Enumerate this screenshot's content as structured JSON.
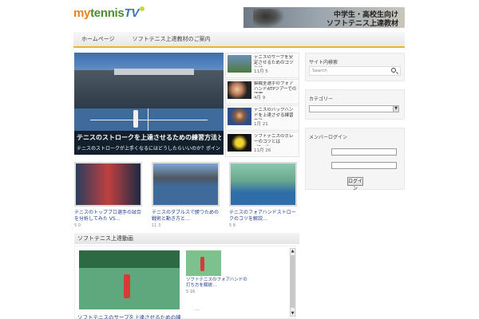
{
  "site": {
    "logo_part1": "my",
    "logo_part2": "tennis",
    "logo_part3": "TV"
  },
  "banner": {
    "line1": "中学生・高校生向け",
    "line2": "ソフトテニス上達教材"
  },
  "nav": {
    "items": [
      "ホームページ",
      "ソフトテニス上達教材のご案内"
    ]
  },
  "featured": {
    "title": "テニスのストロークを上達させるための練習方法とは…",
    "subtitle": "テニスのストロークが上手くなるにはどうしたらいいのか？ポイントを解説"
  },
  "side_list": [
    {
      "title": "テニスのサーブを安定させるためのコツとは…",
      "date": "11月 5"
    },
    {
      "title": "錦織圭選手のフォアハンドATPツアーでの活躍…",
      "date": "4月 9"
    },
    {
      "title": "テニスのバックハンドを上達させる練習方法…",
      "date": "1月 21"
    },
    {
      "title": "ソフトテニスのボレーのコツとは（Part）…",
      "date": "11月 26"
    }
  ],
  "grid": [
    {
      "title": "テニスのトッププロ選手の試合を分析してみた VS…",
      "meta": "5 0"
    },
    {
      "title": "テニスのダブルスで勝つための戦術と動き方と…",
      "meta": "11 3"
    },
    {
      "title": "テニスのフォアハンドストロークのコツを解説…",
      "meta": "5 8"
    }
  ],
  "section": {
    "header": "ソフトテニス上達動画"
  },
  "lower": {
    "small_title": "ソフトテニスのフォアハンドの打ち方を解説…",
    "small_meta": "5 16",
    "dots": "...",
    "caption": "ソフトテニスのサーブを上達させるための練習法"
  },
  "sidebar": {
    "search_title": "サイト内検索",
    "search_placeholder": "Search",
    "category_title": "カテゴリー",
    "login_title": "メンバーログイン",
    "login_user_label": "",
    "login_pass_label": "",
    "login_button": "ログイン"
  }
}
